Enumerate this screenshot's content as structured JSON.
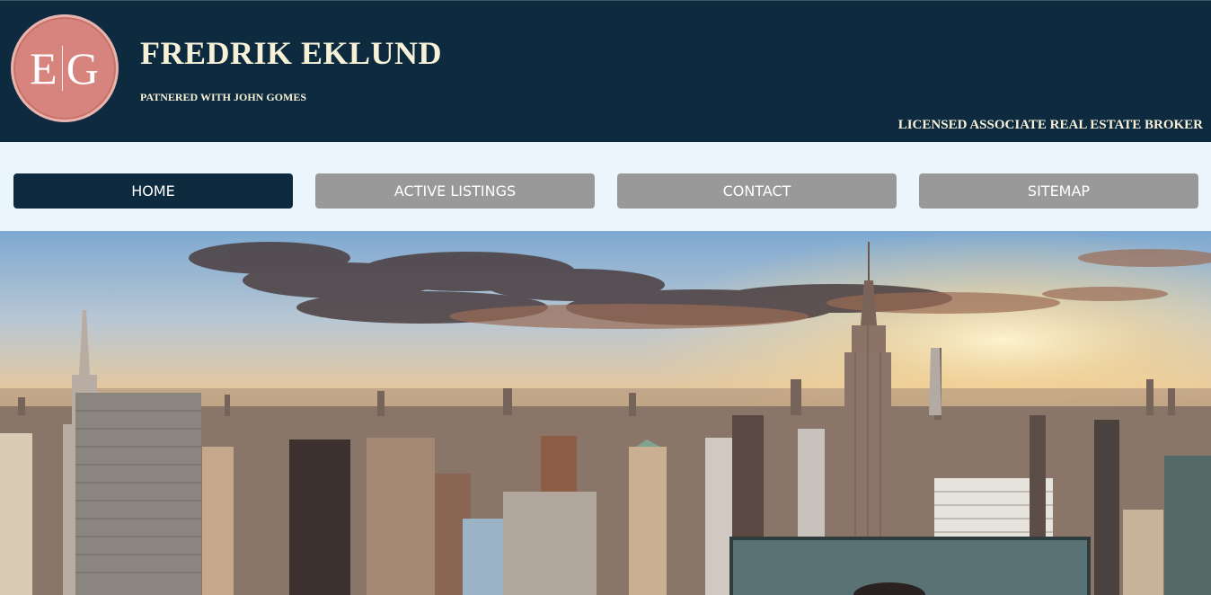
{
  "header": {
    "logo_initials_left": "E",
    "logo_initials_right": "G",
    "title": "FREDRIK EKLUND",
    "subtitle": "PATNERED WITH JOHN GOMES",
    "tagline": "LICENSED ASSOCIATE REAL ESTATE BROKER"
  },
  "nav": {
    "items": [
      {
        "label": "HOME",
        "active": true
      },
      {
        "label": "ACTIVE LISTINGS",
        "active": false
      },
      {
        "label": "CONTACT",
        "active": false
      },
      {
        "label": "SITEMAP",
        "active": false
      }
    ]
  },
  "colors": {
    "header_bg": "#0d2a3f",
    "nav_bg": "#eaf6fc",
    "nav_active": "#0d2a3f",
    "nav_inactive": "#999999",
    "logo_bg": "#d6847d",
    "title_text": "#f7f1d8"
  }
}
